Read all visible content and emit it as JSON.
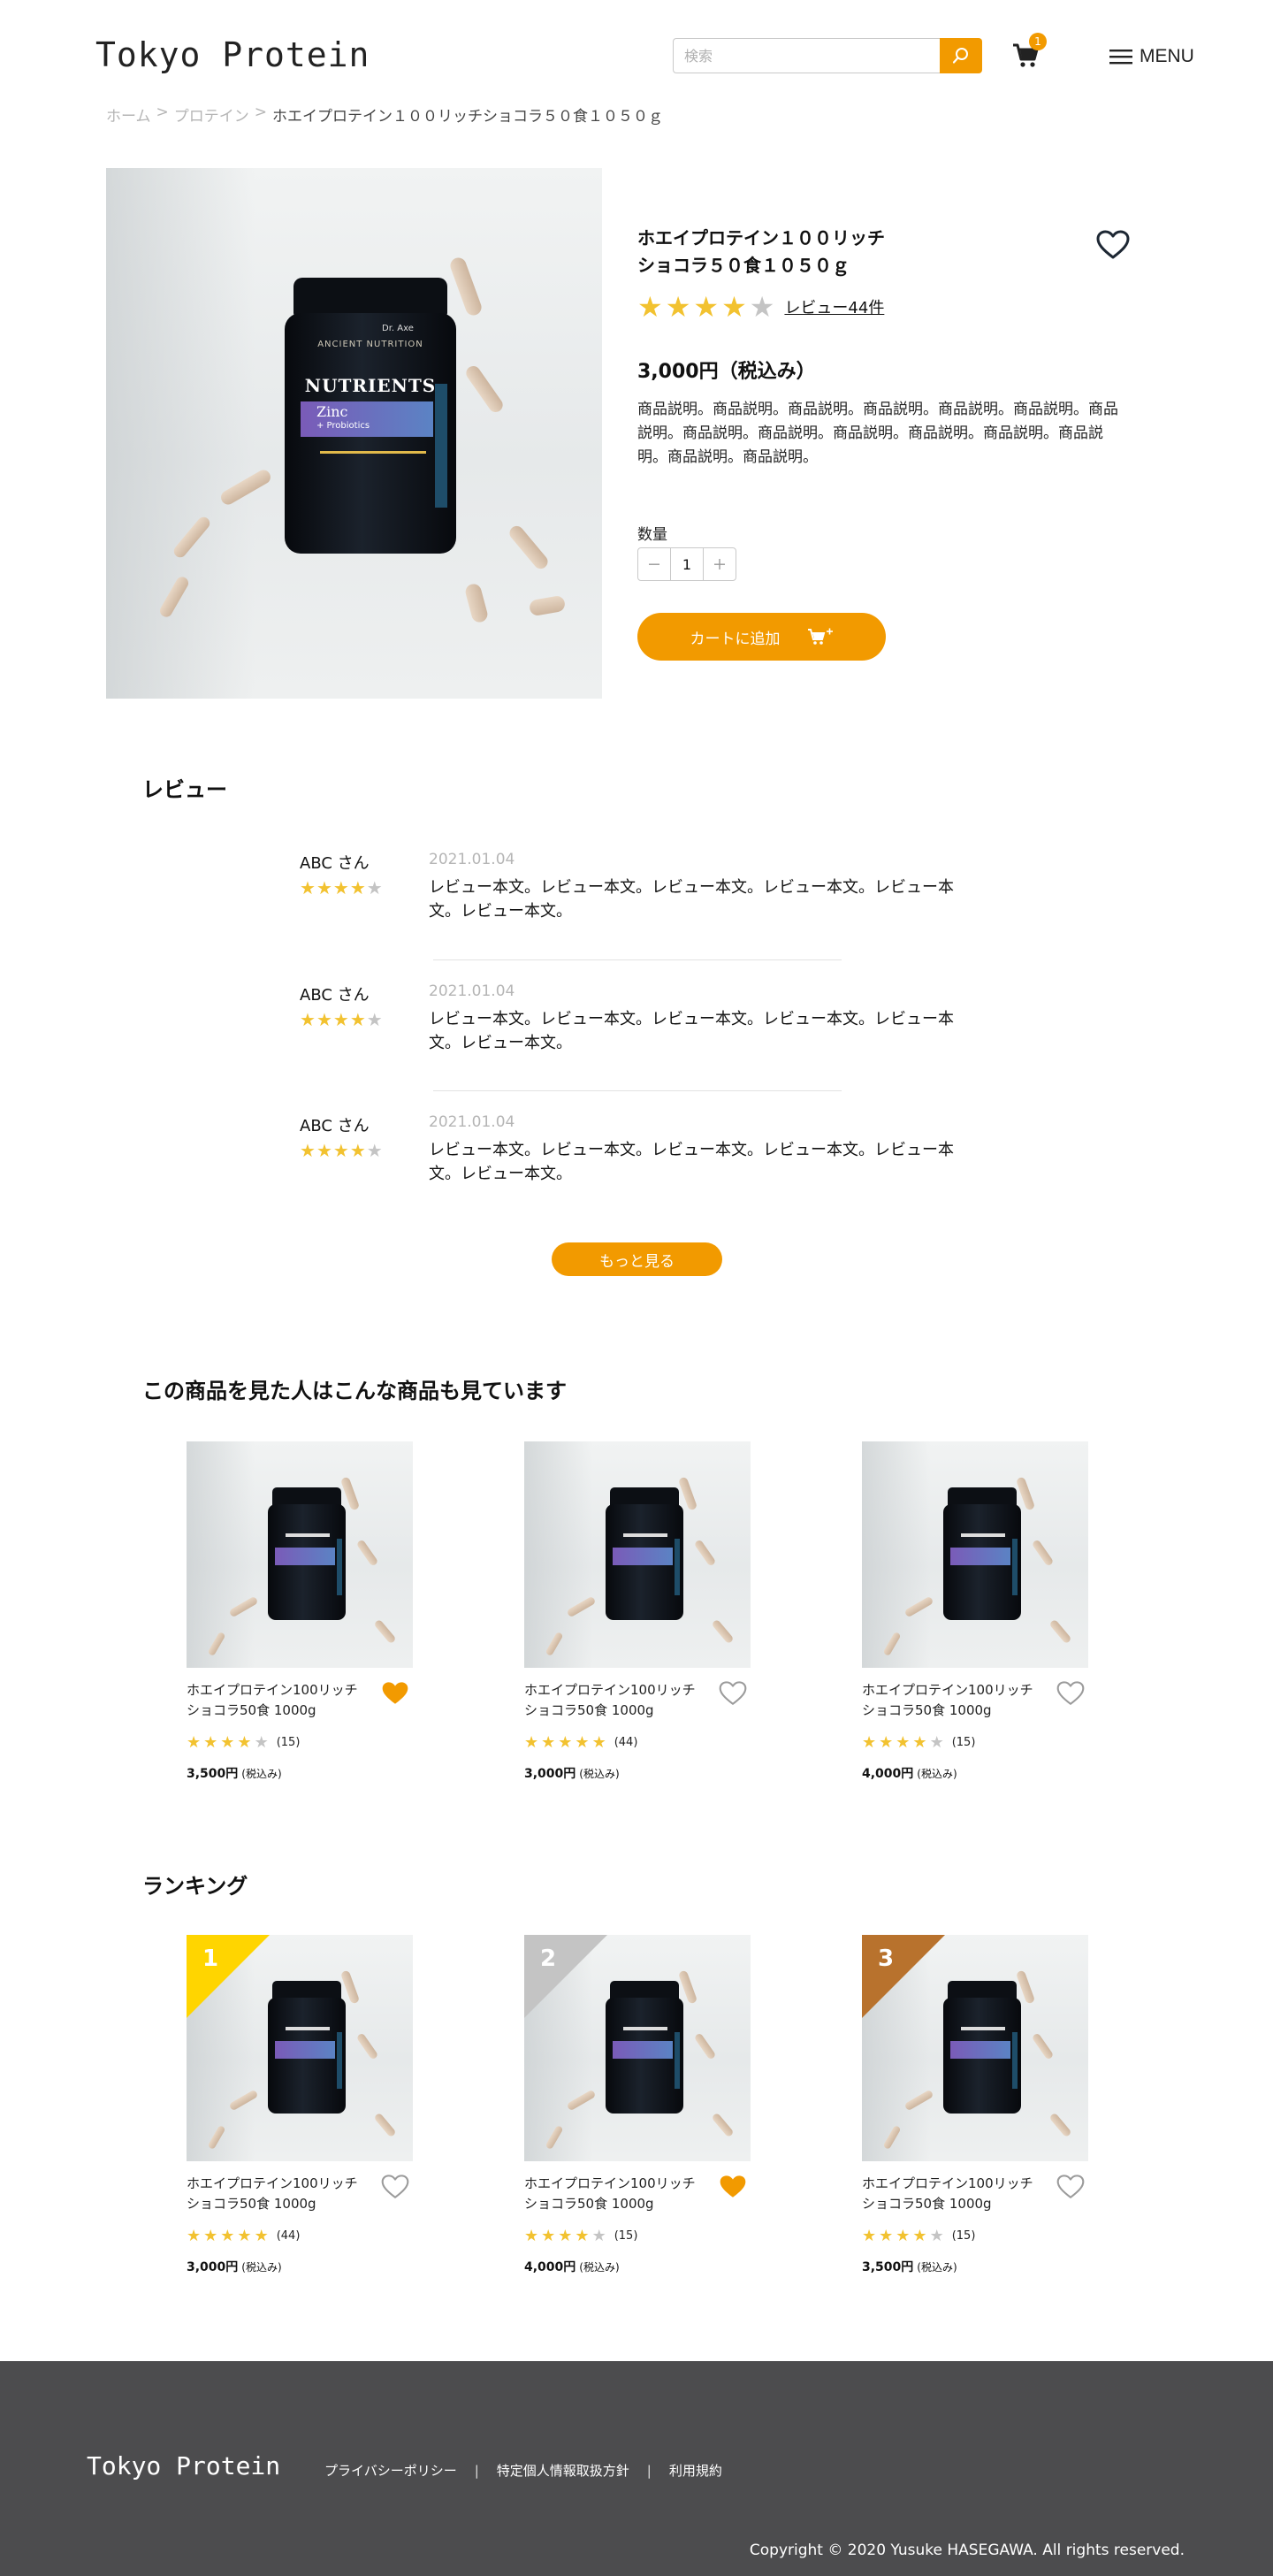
{
  "header": {
    "logo": "Tokyo Protein",
    "search_placeholder": "検索",
    "cart_count": "1",
    "menu_label": "MENU"
  },
  "breadcrumb": {
    "home": "ホーム",
    "category": "プロテイン",
    "separator": ">",
    "current": "ホエイプロテイン１００リッチショコラ５０食１０５０ｇ"
  },
  "product": {
    "title_line1": "ホエイプロテイン１００リッチ",
    "title_line2": "ショコラ５０食１０５０ｇ",
    "rating": 4,
    "review_link": "レビュー44件",
    "price": "3,000円（税込み）",
    "description": "商品説明。商品説明。商品説明。商品説明。商品説明。商品説明。商品説明。商品説明。商品説明。商品説明。商品説明。商品説明。商品説明。商品説明。商品説明。",
    "quantity_label": "数量",
    "quantity": "1",
    "add_to_cart": "カートに追加",
    "bottle_label": {
      "brand": "Dr. Axe",
      "maker": "ANCIENT NUTRITION",
      "product": "NUTRIENTS",
      "flavor": "Zinc",
      "sub": "+ Probiotics"
    }
  },
  "reviews": {
    "title": "レビュー",
    "items": [
      {
        "name": "ABC さん",
        "date": "2021.01.04",
        "rating": 4,
        "body": "レビュー本文。レビュー本文。レビュー本文。レビュー本文。レビュー本文。レビュー本文。"
      },
      {
        "name": "ABC さん",
        "date": "2021.01.04",
        "rating": 4,
        "body": "レビュー本文。レビュー本文。レビュー本文。レビュー本文。レビュー本文。レビュー本文。"
      },
      {
        "name": "ABC さん",
        "date": "2021.01.04",
        "rating": 4,
        "body": "レビュー本文。レビュー本文。レビュー本文。レビュー本文。レビュー本文。レビュー本文。"
      }
    ],
    "more_button": "もっと見る"
  },
  "related": {
    "title": "この商品を見た人はこんな商品も見ています",
    "items": [
      {
        "name": "ホエイプロテイン100リッチショコラ50食 1000g",
        "rating": 4,
        "count": "(15)",
        "price": "3,500円",
        "tax": "(税込み)",
        "favorited": true
      },
      {
        "name": "ホエイプロテイン100リッチショコラ50食 1000g",
        "rating": 5,
        "count": "(44)",
        "price": "3,000円",
        "tax": "(税込み)",
        "favorited": false
      },
      {
        "name": "ホエイプロテイン100リッチショコラ50食 1000g",
        "rating": 4,
        "count": "(15)",
        "price": "4,000円",
        "tax": "(税込み)",
        "favorited": false
      }
    ]
  },
  "ranking": {
    "title": "ランキング",
    "items": [
      {
        "rank": "1",
        "rank_color": "#ffd500",
        "name": "ホエイプロテイン100リッチショコラ50食 1000g",
        "rating": 5,
        "count": "(44)",
        "price": "3,000円",
        "tax": "(税込み)",
        "favorited": false
      },
      {
        "rank": "2",
        "rank_color": "#c4c4c4",
        "name": "ホエイプロテイン100リッチショコラ50食 1000g",
        "rating": 4,
        "count": "(15)",
        "price": "4,000円",
        "tax": "(税込み)",
        "favorited": true
      },
      {
        "rank": "3",
        "rank_color": "#b8722d",
        "name": "ホエイプロテイン100リッチショコラ50食 1000g",
        "rating": 4,
        "count": "(15)",
        "price": "3,500円",
        "tax": "(税込み)",
        "favorited": false
      }
    ]
  },
  "footer": {
    "logo": "Tokyo Protein",
    "links": [
      "プライバシーポリシー",
      "特定個人情報取扱方針",
      "利用規約"
    ],
    "separator": "|",
    "copyright": "Copyright © 2020 Yusuke HASEGAWA. All rights reserved."
  },
  "colors": {
    "accent": "#f29a00",
    "star_on": "#f2c230",
    "star_off": "#c4c4c4",
    "footer_bg": "#4c4c4e",
    "heart_filled": "#f29a00"
  },
  "icons": {
    "search": "search-icon",
    "cart": "cart-icon",
    "menu": "hamburger-icon",
    "favorite": "heart-icon",
    "add_cart": "cart-plus-icon",
    "minus": "minus-icon",
    "plus": "plus-icon"
  }
}
